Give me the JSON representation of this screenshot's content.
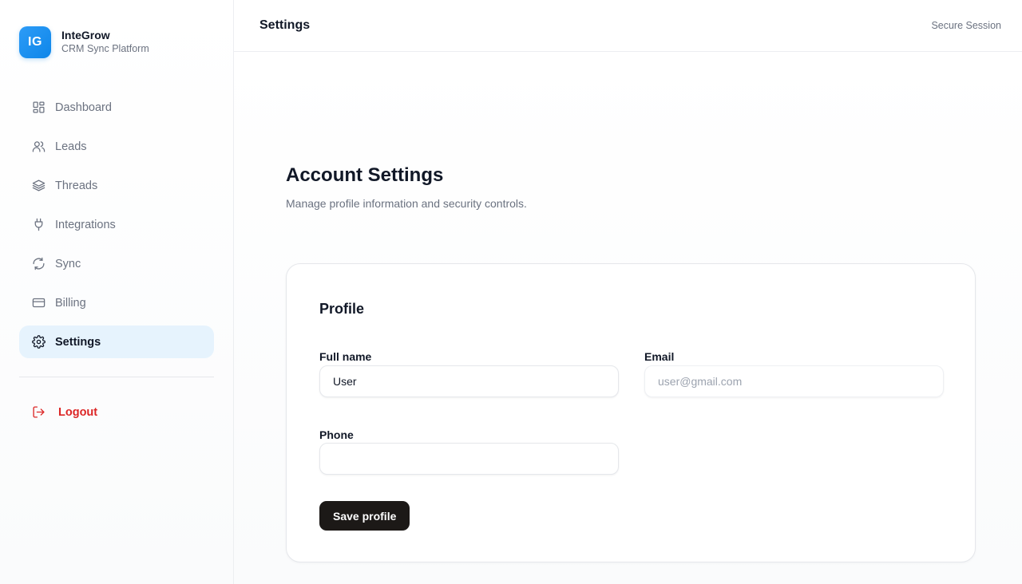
{
  "brand": {
    "logo_initials": "IG",
    "name": "InteGrow",
    "subtitle": "CRM Sync Platform"
  },
  "sidebar": {
    "items": [
      {
        "label": "Dashboard",
        "icon": "dashboard-icon"
      },
      {
        "label": "Leads",
        "icon": "users-icon"
      },
      {
        "label": "Threads",
        "icon": "layers-icon"
      },
      {
        "label": "Integrations",
        "icon": "plug-icon"
      },
      {
        "label": "Sync",
        "icon": "refresh-icon"
      },
      {
        "label": "Billing",
        "icon": "credit-card-icon"
      },
      {
        "label": "Settings",
        "icon": "gear-icon",
        "active": true
      }
    ],
    "logout_label": "Logout"
  },
  "topbar": {
    "title": "Settings",
    "right_text": "Secure Session"
  },
  "page": {
    "title": "Account Settings",
    "subtitle": "Manage profile information and security controls."
  },
  "profile_card": {
    "title": "Profile",
    "full_name": {
      "label": "Full name",
      "value": "User"
    },
    "email": {
      "label": "Email",
      "value": "",
      "placeholder": "user@gmail.com"
    },
    "phone": {
      "label": "Phone",
      "value": ""
    },
    "save_label": "Save profile"
  },
  "colors": {
    "accent": "#0e86e9",
    "active_bg": "#e6f3fd",
    "danger": "#dc2626",
    "button_bg": "#1c1917"
  }
}
